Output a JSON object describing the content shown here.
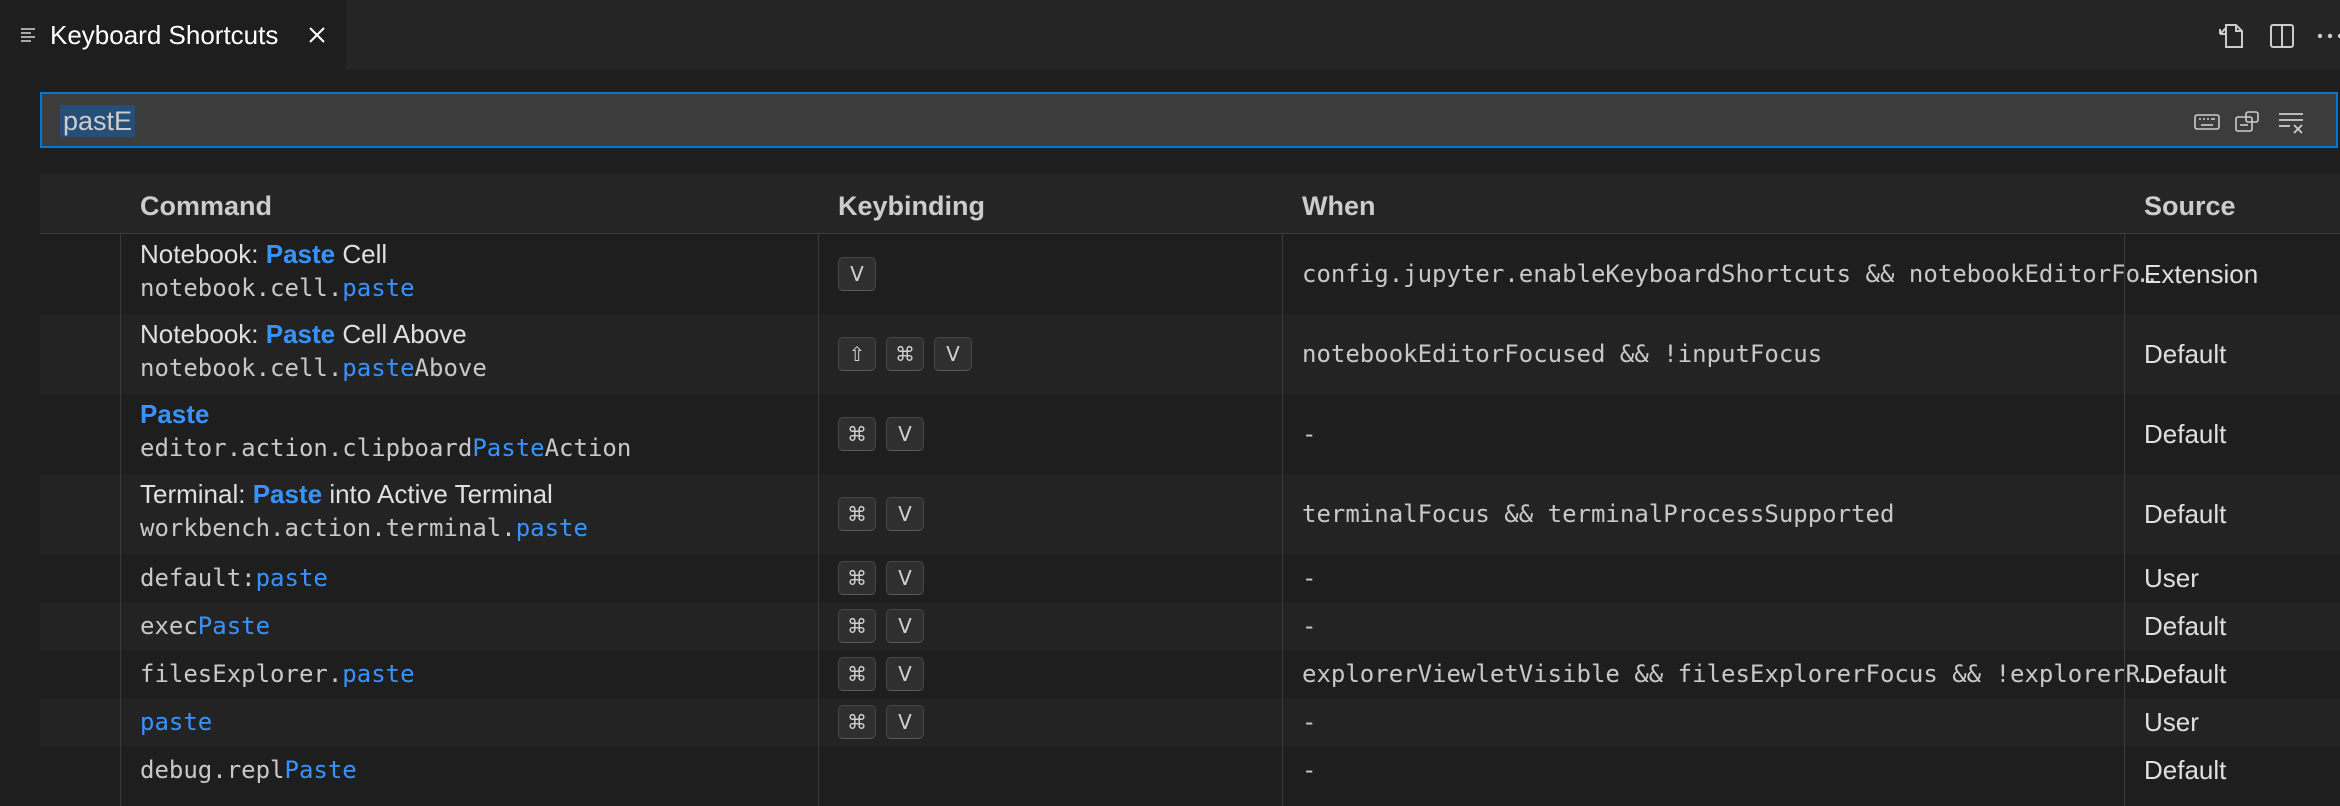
{
  "tab": {
    "title": "Keyboard Shortcuts"
  },
  "search": {
    "value": "pastE"
  },
  "columns": {
    "command": "Command",
    "keybinding": "Keybinding",
    "when": "When",
    "source": "Source"
  },
  "rows": [
    {
      "title_parts": [
        "Notebook: ",
        "Paste",
        " Cell"
      ],
      "id_parts": [
        "notebook.cell.",
        "paste",
        ""
      ],
      "keys": [
        "V"
      ],
      "when": "config.jupyter.enableKeyboardShortcuts && notebookEditorFocused",
      "source": "Extension"
    },
    {
      "title_parts": [
        "Notebook: ",
        "Paste",
        " Cell Above"
      ],
      "id_parts": [
        "notebook.cell.",
        "paste",
        "Above"
      ],
      "keys": [
        "⇧",
        "⌘",
        "V"
      ],
      "when": "notebookEditorFocused && !inputFocus",
      "source": "Default"
    },
    {
      "title_parts": [
        "",
        "Paste",
        ""
      ],
      "id_parts": [
        "editor.action.clipboard",
        "Paste",
        "Action"
      ],
      "keys": [
        "⌘",
        "V"
      ],
      "when": "-",
      "source": "Default"
    },
    {
      "title_parts": [
        "Terminal: ",
        "Paste",
        " into Active Terminal"
      ],
      "id_parts": [
        "workbench.action.terminal.",
        "paste",
        ""
      ],
      "keys": [
        "⌘",
        "V"
      ],
      "when": "terminalFocus && terminalProcessSupported",
      "source": "Default"
    },
    {
      "id_parts": [
        "default:",
        "paste",
        ""
      ],
      "keys": [
        "⌘",
        "V"
      ],
      "when": "-",
      "source": "User"
    },
    {
      "id_parts": [
        "exec",
        "Paste",
        ""
      ],
      "keys": [
        "⌘",
        "V"
      ],
      "when": "-",
      "source": "Default"
    },
    {
      "id_parts": [
        "filesExplorer.",
        "paste",
        ""
      ],
      "keys": [
        "⌘",
        "V"
      ],
      "when": "explorerViewletVisible && filesExplorerFocus && !explorerResourceReadonly",
      "source": "Default"
    },
    {
      "id_parts": [
        "",
        "paste",
        ""
      ],
      "keys": [
        "⌘",
        "V"
      ],
      "when": "-",
      "source": "User"
    },
    {
      "id_parts": [
        "debug.repl",
        "Paste",
        ""
      ],
      "keys": [],
      "when": "-",
      "source": "Default"
    }
  ],
  "icons": {
    "tab": "keyboard-shortcuts-list-icon",
    "close": "close-icon",
    "open_json": "open-keybindings-json-icon",
    "split": "split-editor-icon",
    "more": "more-actions-icon",
    "record_keys": "record-keys-icon",
    "sort_precedence": "sort-by-precedence-icon",
    "clear": "clear-search-icon"
  }
}
